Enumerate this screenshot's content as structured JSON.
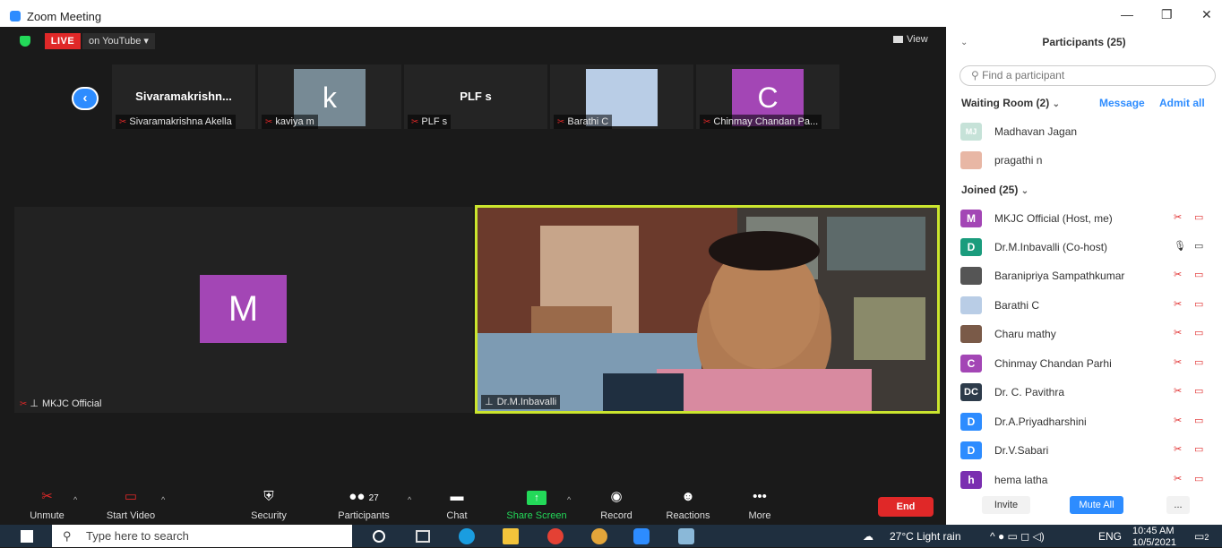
{
  "window": {
    "title": "Zoom Meeting",
    "minimize": "—",
    "restore": "❐",
    "close": "✕"
  },
  "stage": {
    "live_label": "LIVE",
    "live_on": "on YouTube ▾",
    "view_label": "View",
    "thumbnails": [
      {
        "name": "Sivaramakrishn...",
        "label": "Sivaramakrishna Akella"
      },
      {
        "avatar": "k",
        "label": "kaviya m",
        "color": "#778a95"
      },
      {
        "name": "PLF s",
        "label": "PLF s"
      },
      {
        "label": "Barathi C",
        "color": "#b9cde6"
      },
      {
        "avatar": "C",
        "label": "Chinmay Chandan Pa...",
        "color": "#a346b5"
      }
    ],
    "big_avatar": "M",
    "big_label": "MKJC Official",
    "video_label": "Dr.M.Inbavalli"
  },
  "toolbar": {
    "unmute": "Unmute",
    "start_video": "Start Video",
    "security": "Security",
    "participants": "Participants",
    "participants_count": "27",
    "chat": "Chat",
    "share_screen": "Share Screen",
    "record": "Record",
    "reactions": "Reactions",
    "more": "More",
    "end": "End"
  },
  "panel": {
    "title": "Participants (25)",
    "search_placeholder": "Find a participant",
    "waiting_label": "Waiting Room (2)",
    "message": "Message",
    "admit_all": "Admit all",
    "waiting": [
      {
        "initials": "MJ",
        "name": "Madhavan Jagan",
        "color": "#c6e2d8"
      },
      {
        "initials": "",
        "name": "pragathi n",
        "color": "#e8b7a5"
      }
    ],
    "joined_label": "Joined (25)",
    "joined": [
      {
        "initials": "M",
        "name": "MKJC Official (Host, me)",
        "color": "#a346b5",
        "mic": "✂",
        "cam": "▭"
      },
      {
        "initials": "D",
        "name": "Dr.M.Inbavalli (Co-host)",
        "color": "#1a9c7d",
        "mic": "🎙",
        "cam": "▭"
      },
      {
        "initials": "",
        "name": "Baranipriya Sampathkumar",
        "color": "#555555",
        "mic": "✂",
        "cam": "▭"
      },
      {
        "initials": "",
        "name": "Barathi C",
        "color": "#b9cde6",
        "mic": "✂",
        "cam": "▭"
      },
      {
        "initials": "",
        "name": "Charu mathy",
        "color": "#7a5a48",
        "mic": "✂",
        "cam": "▭"
      },
      {
        "initials": "C",
        "name": "Chinmay Chandan Parhi",
        "color": "#a346b5",
        "mic": "✂",
        "cam": "▭"
      },
      {
        "initials": "DC",
        "name": "Dr. C. Pavithra",
        "color": "#2d3b4a",
        "mic": "✂",
        "cam": "▭"
      },
      {
        "initials": "D",
        "name": "Dr.A.Priyadharshini",
        "color": "#2d8cff",
        "mic": "✂",
        "cam": "▭"
      },
      {
        "initials": "D",
        "name": "Dr.V.Sabari",
        "color": "#2d8cff",
        "mic": "✂",
        "cam": "▭"
      },
      {
        "initials": "h",
        "name": "hema latha",
        "color": "#7a2fb0",
        "mic": "✂",
        "cam": "▭"
      }
    ],
    "invite": "Invite",
    "mute_all": "Mute All",
    "more": "..."
  },
  "taskbar": {
    "search_placeholder": "Type here to search",
    "weather": "27°C  Light rain",
    "lang": "ENG",
    "time": "10:45 AM",
    "date": "10/5/2021",
    "notif_count": "2"
  }
}
